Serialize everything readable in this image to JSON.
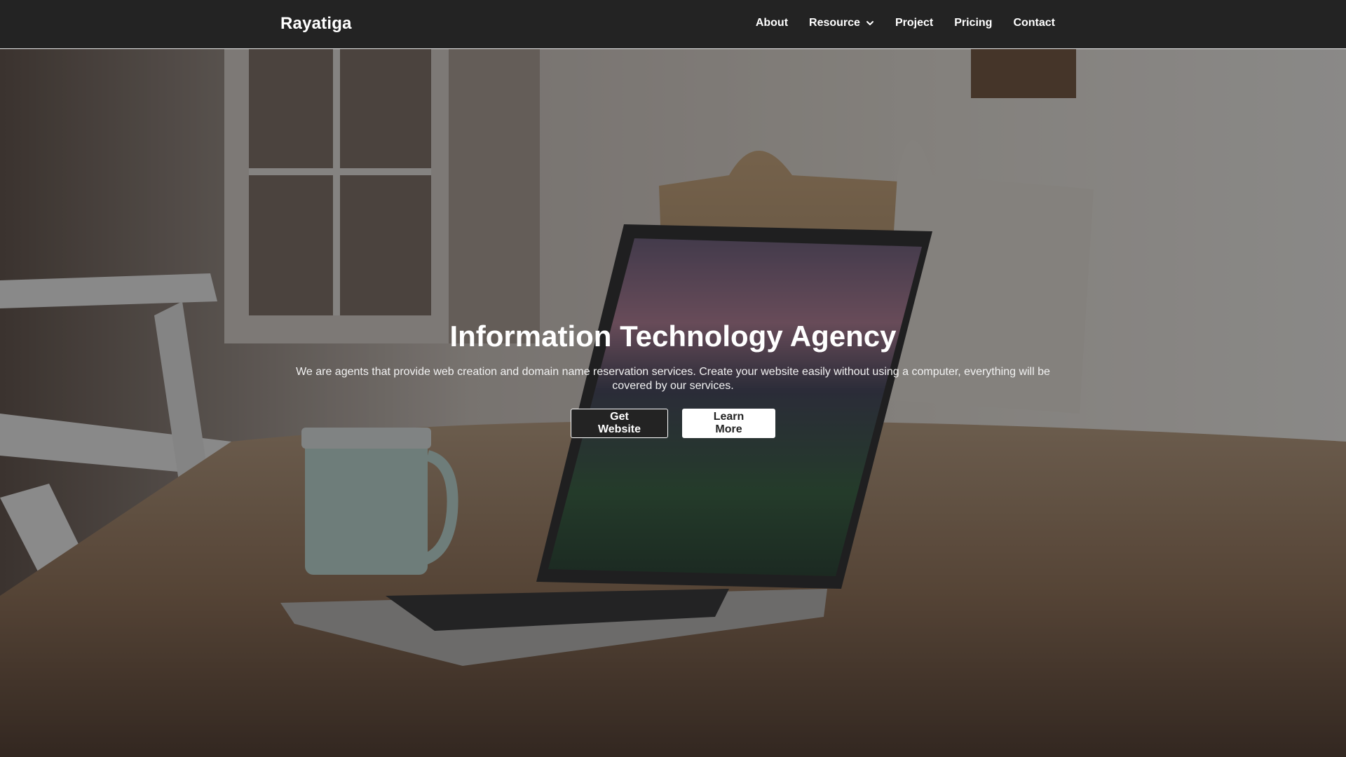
{
  "navbar": {
    "brand": "Rayatiga",
    "items": [
      {
        "label": "About"
      },
      {
        "label": "Resource"
      },
      {
        "label": "Project"
      },
      {
        "label": "Pricing"
      },
      {
        "label": "Contact"
      }
    ]
  },
  "hero": {
    "title": "Information Technology Agency",
    "description": "We are agents that provide web creation and domain name reservation services. Create your website easily without using a computer, everything will be covered by our services.",
    "primary_button": "Get Website",
    "secondary_button": "Learn More",
    "background_photo": "laptop-on-wooden-table"
  },
  "colors": {
    "navbar_bg": "#232323",
    "text": "#ffffff",
    "button_dark": "#232323",
    "button_light": "#ffffff"
  }
}
